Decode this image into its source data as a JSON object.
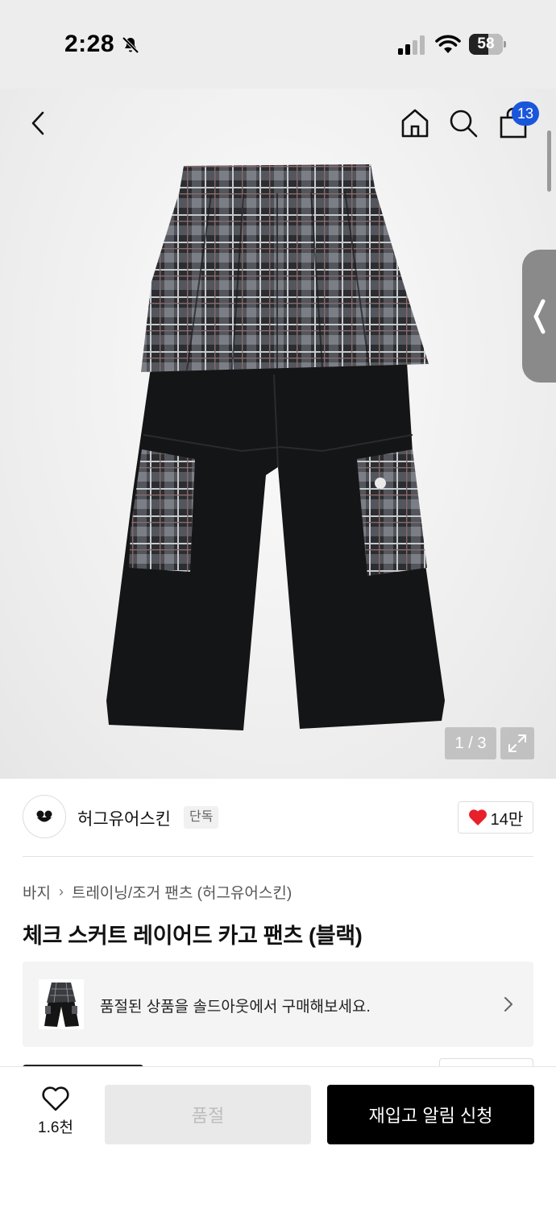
{
  "status_bar": {
    "time": "2:28",
    "battery": "58",
    "battery_level": 0.58
  },
  "nav": {
    "cart_count": "13"
  },
  "gallery": {
    "pager": "1 / 3"
  },
  "brand": {
    "name": "허그유어스킨",
    "badge": "단독",
    "likes": "14만"
  },
  "breadcrumb": {
    "category": "바지",
    "subcategory": "트레이닝/조거 팬츠 (허그유어스킨)"
  },
  "product": {
    "title": "체크 스커트 레이어드 카고 팬츠 (블랙)"
  },
  "soldout_banner": {
    "text": "품절된 상품을 솔드아웃에서 구매해보세요."
  },
  "bottom_bar": {
    "wish_count": "1.6천",
    "soldout_label": "품절",
    "restock_label": "재입고 알림 신청"
  },
  "colors": {
    "badge_blue": "#1a56db",
    "heart_red": "#e8202a",
    "primary_button": "#000000",
    "disabled_button": "#e9e9e9"
  }
}
